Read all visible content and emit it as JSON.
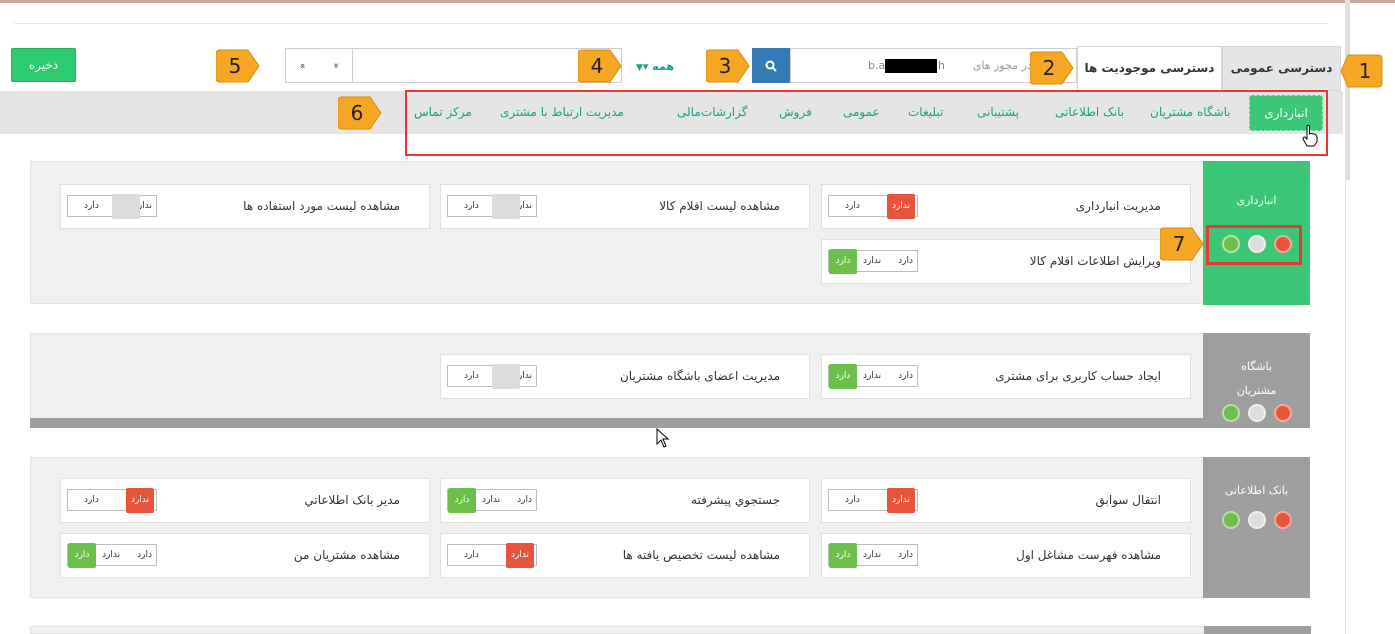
{
  "toolbar": {
    "save_label": "ذخیره",
    "nav_up_icon": "»",
    "nav_down_icon": "«",
    "filter_label": "همه",
    "search_placeholder": "جستجو در مجوز های",
    "search_prefix": "b.a",
    "search_suffix": "h"
  },
  "tabs": {
    "general": "دسترسی عمومی",
    "entity": "دسترسی موجودیت ها"
  },
  "categories": {
    "active": "انبارداری",
    "items": [
      "باشگاه مشتریان",
      "بانک اطلاعاتی",
      "پشتیبانی",
      "تبلیغات",
      "عمومی",
      "فروش",
      "گزارشات",
      "مالی",
      "مدیریت ارتباط با مشتری",
      "مرکز تماس"
    ]
  },
  "markers": [
    "1",
    "2",
    "3",
    "4",
    "5",
    "6",
    "7"
  ],
  "toggle": {
    "off": "ندارد",
    "on": "دارد"
  },
  "panels": [
    {
      "title": "انبارداری",
      "color": "#3cc678",
      "dots": [
        "green",
        "white",
        "red"
      ],
      "cards": [
        {
          "label": "مدیریت انبارداری",
          "state": "no"
        },
        {
          "label": "مشاهده لیست اقلام کالا",
          "state": "neutral"
        },
        {
          "label": "مشاهده لیست مورد استفاده ها",
          "state": "neutral"
        },
        {
          "label": "ویرایش اطلاعات اقلام کالا",
          "state": "yes"
        }
      ]
    },
    {
      "title": "باشگاه مشتریان",
      "color": "#9e9e9e",
      "dots": [
        "green",
        "white",
        "red"
      ],
      "cards": [
        {
          "label": "ایجاد حساب کاربری برای مشتری",
          "state": "yes"
        },
        {
          "label": "مدیریت اعضای باشگاه مشتریان",
          "state": "neutral"
        }
      ]
    },
    {
      "title": "بانک اطلاعاتی",
      "color": "#9e9e9e",
      "dots": [
        "green",
        "white",
        "red"
      ],
      "cards": [
        {
          "label": "انتقال سوابق",
          "state": "no"
        },
        {
          "label": "جستجوي پيشرفته",
          "state": "yes"
        },
        {
          "label": "مدیر بانک اطلاعاتي",
          "state": "no"
        },
        {
          "label": "مشاهده فهرست مشاغل اول",
          "state": "yes"
        },
        {
          "label": "مشاهده لیست تخصیص یافته ها",
          "state": "no"
        },
        {
          "label": "مشاهده مشتریان من",
          "state": "yes"
        }
      ]
    }
  ],
  "colors": {
    "accent_green": "#2ecc71",
    "link_teal": "#16a085",
    "search_blue": "#337ab7",
    "marker_orange": "#f5a623",
    "highlight_red": "#e53935"
  }
}
